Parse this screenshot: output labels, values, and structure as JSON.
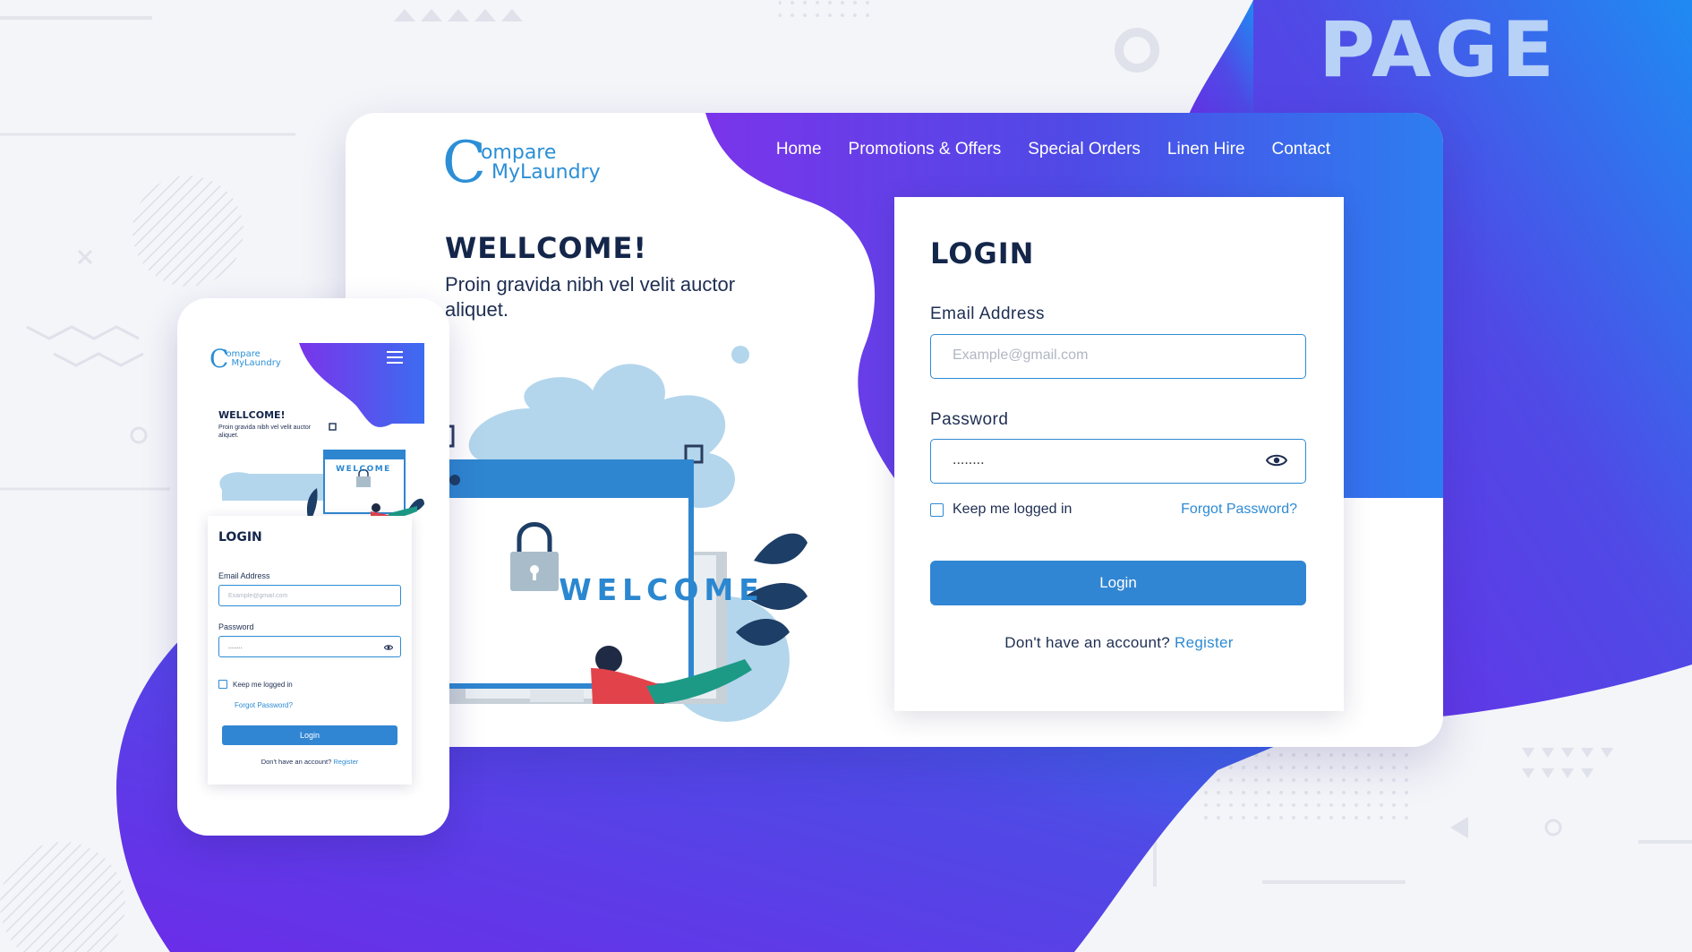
{
  "hero_word": "PAGE",
  "brand": {
    "mark": "C",
    "line1": "ompare",
    "line2": "MyLaundry"
  },
  "nav": {
    "items": [
      "Home",
      "Promotions & Offers",
      "Special Orders",
      "Linen Hire",
      "Contact"
    ]
  },
  "hero": {
    "title": "WELLCOME!",
    "subtitle": "Proin gravida nibh vel velit auctor aliquet.",
    "illustration_text": "WELCOME"
  },
  "login": {
    "title": "LOGIN",
    "email_label": "Email Address",
    "email_placeholder": "Example@gmail.com",
    "password_label": "Password",
    "password_value": "........",
    "remember_label": "Keep me logged in",
    "forgot_label": "Forgot Password?",
    "button_label": "Login",
    "signup_prompt": "Don't have an account?",
    "signup_link": "Register"
  },
  "colors": {
    "accent_blue": "#3186d3",
    "gradient_purple": "#6a2ee6",
    "gradient_blue": "#2f7df0",
    "heading_navy": "#14264a"
  },
  "icons": {
    "eye": "eye-icon",
    "menu": "hamburger-menu-icon",
    "lock": "padlock-icon"
  }
}
